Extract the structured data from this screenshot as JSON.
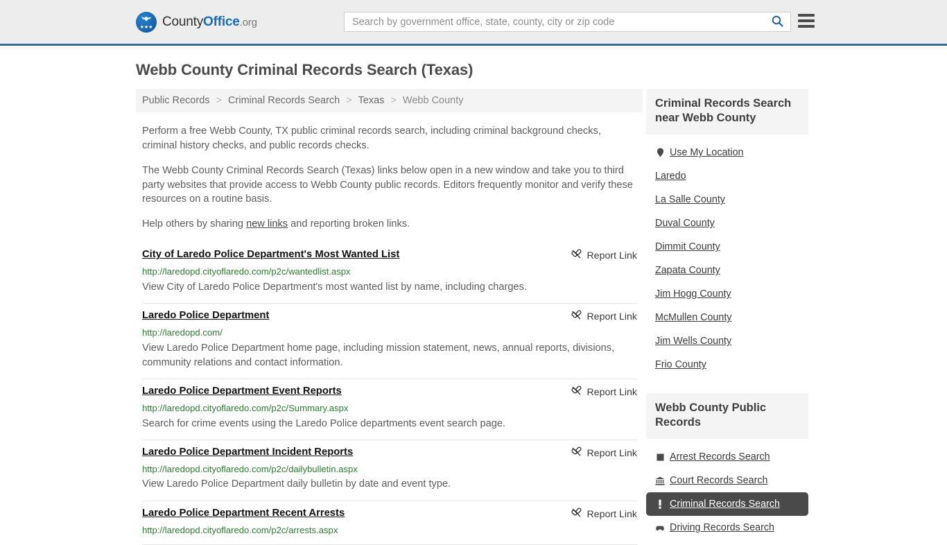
{
  "header": {
    "logo": {
      "part1": "County",
      "part2": "Office",
      "part3": ".org",
      "eagle_icon": "eagle-icon",
      "stars_icon": "stars-icon"
    },
    "search": {
      "placeholder": "Search by government office, state, county, city or zip code",
      "value": "",
      "search_icon": "search-icon"
    },
    "menu_icon": "hamburger-menu-icon",
    "accent_color": "#35699a",
    "background_color": "#ededed"
  },
  "page": {
    "title": "Webb County Criminal Records Search (Texas)"
  },
  "breadcrumb": {
    "separator": ">",
    "items": [
      {
        "label": "Public Records"
      },
      {
        "label": "Criminal Records Search"
      },
      {
        "label": "Texas"
      },
      {
        "label": "Webb County"
      }
    ]
  },
  "intro": {
    "paragraph1": "Perform a free Webb County, TX public criminal records search, including criminal background checks, criminal history checks, and public records checks.",
    "paragraph2": "The Webb County Criminal Records Search (Texas) links below open in a new window and take you to third party websites that provide access to Webb County public records. Editors frequently monitor and verify these resources on a routine basis.",
    "paragraph3_before": "Help others by sharing ",
    "paragraph3_link": "new links",
    "paragraph3_after": " and reporting broken links."
  },
  "results": {
    "report_label": "Report Link",
    "report_icon": "broken-link-icon",
    "items": [
      {
        "title": "City of Laredo Police Department's Most Wanted List",
        "url": "http://laredopd.cityoflaredo.com/p2c/wantedlist.aspx",
        "description": "View City of Laredo Police Department's most wanted list by name, including charges."
      },
      {
        "title": "Laredo Police Department",
        "url": "http://laredopd.com/",
        "description": "View Laredo Police Department home page, including mission statement, news, annual reports, divisions, community relations and contact information."
      },
      {
        "title": "Laredo Police Department Event Reports",
        "url": "http://laredopd.cityoflaredo.com/p2c/Summary.aspx",
        "description": "Search for crime events using the Laredo Police departments event search page."
      },
      {
        "title": "Laredo Police Department Incident Reports",
        "url": "http://laredopd.cityoflaredo.com/p2c/dailybulletin.aspx",
        "description": "View Laredo Police Department daily bulletin by date and event type."
      },
      {
        "title": "Laredo Police Department Recent Arrests",
        "url": "http://laredopd.cityoflaredo.com/p2c/arrests.aspx",
        "description": ""
      }
    ]
  },
  "sidebar": {
    "nearby": {
      "title": "Criminal Records Search near Webb County",
      "items": [
        {
          "label": "Use My Location",
          "icon": "map-pin-icon"
        },
        {
          "label": "Laredo",
          "icon": ""
        },
        {
          "label": "La Salle County",
          "icon": ""
        },
        {
          "label": "Duval County",
          "icon": ""
        },
        {
          "label": "Dimmit County",
          "icon": ""
        },
        {
          "label": "Zapata County",
          "icon": ""
        },
        {
          "label": "Jim Hogg County",
          "icon": ""
        },
        {
          "label": "McMullen County",
          "icon": ""
        },
        {
          "label": "Jim Wells County",
          "icon": ""
        },
        {
          "label": "Frio County",
          "icon": ""
        }
      ]
    },
    "public_records": {
      "title": "Webb County Public Records",
      "items": [
        {
          "label": "Arrest Records Search",
          "icon": "square-icon",
          "active": false
        },
        {
          "label": "Court Records Search",
          "icon": "courthouse-icon",
          "active": false
        },
        {
          "label": "Criminal Records Search",
          "icon": "exclamation-icon",
          "active": true
        },
        {
          "label": "Driving Records Search",
          "icon": "car-icon",
          "active": false
        }
      ]
    }
  }
}
